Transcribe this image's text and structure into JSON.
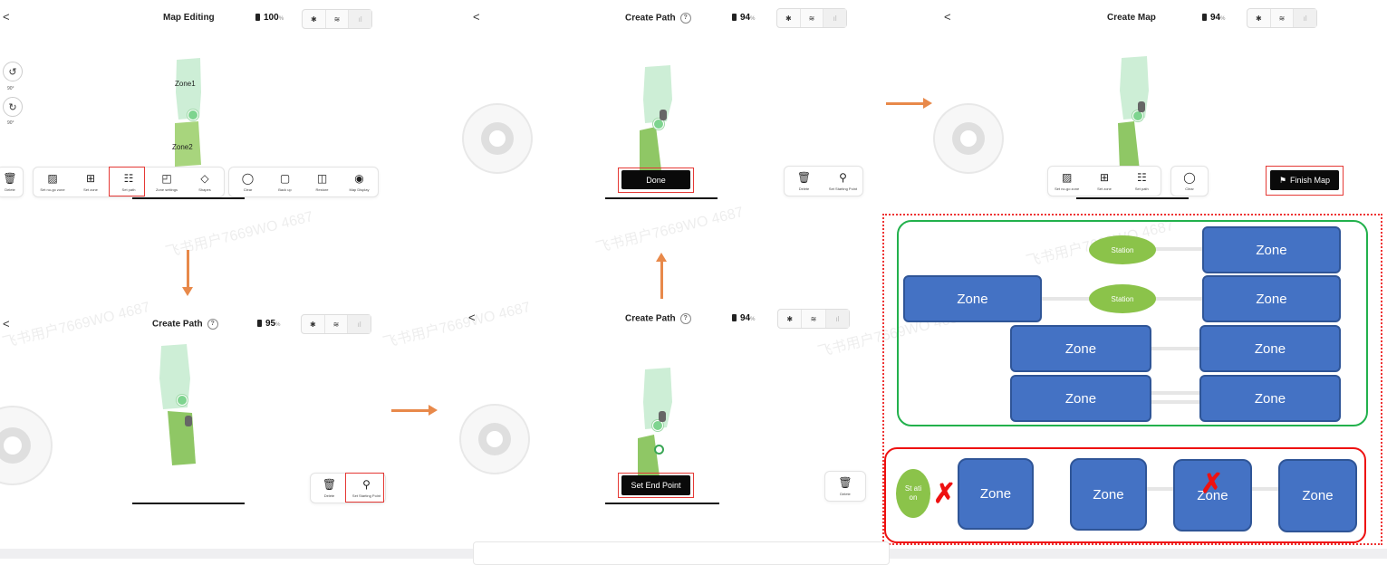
{
  "panel1": {
    "back": "<",
    "title": "Map Editing",
    "battery": "100",
    "battery_unit": "%",
    "status_icons": [
      "bluetooth-icon",
      "wifi-icon",
      "signal-icon"
    ],
    "rotate_ccw_label": "90°",
    "rotate_cw_label": "90°",
    "zone1": "Zone1",
    "zone2": "Zone2",
    "tools": [
      {
        "icon": "trash-icon",
        "label": "Delete"
      },
      {
        "icon": "no-go-icon",
        "label": "Set no-go zone"
      },
      {
        "icon": "zone-icon",
        "label": "Set zone"
      },
      {
        "icon": "path-icon",
        "label": "Set path"
      },
      {
        "icon": "settings-icon",
        "label": "Zone settings"
      },
      {
        "icon": "shapes-icon",
        "label": "Shapes"
      },
      {
        "icon": "clear-icon",
        "label": "Clear"
      },
      {
        "icon": "backup-icon",
        "label": "Back up"
      },
      {
        "icon": "restore-icon",
        "label": "Restore"
      },
      {
        "icon": "eye-icon",
        "label": "Map Display"
      }
    ]
  },
  "panel2": {
    "back": "<",
    "title": "Create Path",
    "help": "?",
    "battery": "95",
    "battery_unit": "%",
    "delete_label": "Delete",
    "set_start_label": "Set Starting Point"
  },
  "panel3": {
    "back": "<",
    "title": "Create Path",
    "help": "?",
    "battery": "94",
    "battery_unit": "%",
    "done_label": "Done",
    "delete_label": "Delete",
    "set_start_label": "Set Starting Point"
  },
  "panel4": {
    "back": "<",
    "title": "Create Path",
    "help": "?",
    "battery": "94",
    "battery_unit": "%",
    "end_point_label": "Set End Point",
    "delete_label": "Delete"
  },
  "panel5": {
    "back": "<",
    "title": "Create Map",
    "battery": "94",
    "battery_unit": "%",
    "tools": [
      {
        "icon": "no-go-icon",
        "label": "Set no-go zone"
      },
      {
        "icon": "zone-icon",
        "label": "Set zone"
      },
      {
        "icon": "path-icon",
        "label": "Set path"
      },
      {
        "icon": "clear-icon",
        "label": "Clear"
      }
    ],
    "finish_label": "Finish Map"
  },
  "diagram": {
    "zone": "Zone",
    "station": "Station",
    "station_broken": "St ati on"
  },
  "watermark": "飞书用户7669WO 4687",
  "colors": {
    "accent_arrow": "#e8894a",
    "zone_blue": "#4472c4",
    "station_green": "#8bc34a",
    "ok_border": "#22b14c",
    "bad_border": "#e11"
  }
}
